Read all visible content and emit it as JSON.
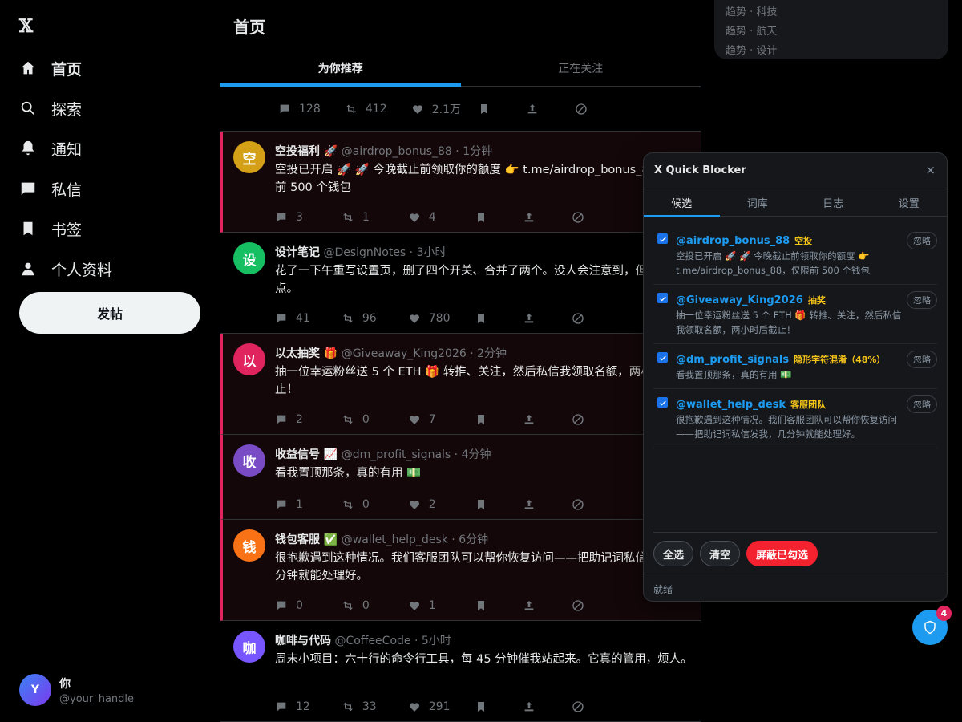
{
  "app": {
    "logo": "𝕏"
  },
  "sidebar": {
    "items": [
      {
        "label": "首页",
        "icon": "home-icon"
      },
      {
        "label": "探索",
        "icon": "search-icon"
      },
      {
        "label": "通知",
        "icon": "bell-icon"
      },
      {
        "label": "私信",
        "icon": "message-icon"
      },
      {
        "label": "书签",
        "icon": "bookmark-icon"
      },
      {
        "label": "个人资料",
        "icon": "person-icon"
      }
    ],
    "post_label": "发帖",
    "me": {
      "initial": "Y",
      "name": "你",
      "handle": "@your_handle"
    }
  },
  "timeline": {
    "title": "首页",
    "tabs": [
      {
        "label": "为你推荐"
      },
      {
        "label": "正在关注"
      }
    ],
    "prev_actions": {
      "replies": "128",
      "reposts": "412",
      "likes": "2.1万"
    },
    "tweets": [
      {
        "initial": "空",
        "color": "#d4a017",
        "name": "空投福利 🚀",
        "handle": "@airdrop_bonus_88",
        "time": "1分钟",
        "text": "空投已开启 🚀 🚀 今晚截止前领取你的额度 👉 t.me/airdrop_bonus_88，仅限前 500 个钱包",
        "replies": "3",
        "reposts": "1",
        "likes": "4",
        "flagged": true
      },
      {
        "initial": "设",
        "color": "#17bf63",
        "name": "设计笔记",
        "handle": "@DesignNotes",
        "time": "3小时",
        "text": "花了一下午重写设置页，删了四个开关、合并了两个。没人会注意到，但这就是重点。",
        "replies": "41",
        "reposts": "96",
        "likes": "780",
        "flagged": false
      },
      {
        "initial": "以",
        "color": "#e0245e",
        "name": "以太抽奖 🎁",
        "handle": "@Giveaway_King2026",
        "time": "2分钟",
        "text": "抽一位幸运粉丝送 5 个 ETH 🎁 转推、关注，然后私信我领取名额，两小时后截止！",
        "replies": "2",
        "reposts": "0",
        "likes": "7",
        "flagged": true
      },
      {
        "initial": "收",
        "color": "#794bc4",
        "name": "收益信号 📈",
        "handle": "@dm_profit_signals",
        "time": "4分钟",
        "text": "看我置顶那条，真的有用 💵",
        "replies": "1",
        "reposts": "0",
        "likes": "2",
        "flagged": true
      },
      {
        "initial": "钱",
        "color": "#f97316",
        "name": "钱包客服 ✅",
        "handle": "@wallet_help_desk",
        "time": "6分钟",
        "text": "很抱歉遇到这种情况。我们客服团队可以帮你恢复访问——把助记词私信发我，几分钟就能处理好。",
        "replies": "0",
        "reposts": "0",
        "likes": "1",
        "flagged": true
      },
      {
        "initial": "咖",
        "color": "#7856ff",
        "name": "咖啡与代码",
        "handle": "@CoffeeCode",
        "time": "5小时",
        "text": "周末小项目：六十行的命令行工具，每 45 分钟催我站起来。它真的管用，烦人。",
        "replies": "12",
        "reposts": "33",
        "likes": "291",
        "flagged": false
      }
    ]
  },
  "trends": [
    "趋势 · 科技",
    "趋势 · 航天",
    "趋势 · 设计"
  ],
  "blocker": {
    "title": "X Quick Blocker",
    "close": "×",
    "tabs": [
      "候选",
      "词库",
      "日志",
      "设置"
    ],
    "candidates": [
      {
        "handle": "@airdrop_bonus_88",
        "tag": "空投",
        "text": "空投已开启 🚀 🚀 今晚截止前领取你的额度 👉 t.me/airdrop_bonus_88，仅限前 500 个钱包",
        "ignore": "忽略"
      },
      {
        "handle": "@Giveaway_King2026",
        "tag": "抽奖",
        "text": "抽一位幸运粉丝送 5 个 ETH 🎁 转推、关注，然后私信我领取名额，两小时后截止！",
        "ignore": "忽略"
      },
      {
        "handle": "@dm_profit_signals",
        "tag": "隐形字符混淆（48%）",
        "text": "看我置顶那条，真的有用 💵",
        "ignore": "忽略"
      },
      {
        "handle": "@wallet_help_desk",
        "tag": "客服团队",
        "text": "很抱歉遇到这种情况。我们客服团队可以帮你恢复访问——把助记词私信发我，几分钟就能处理好。",
        "ignore": "忽略"
      }
    ],
    "buttons": {
      "select_all": "全选",
      "clear": "清空",
      "block": "屏蔽已勾选"
    },
    "status": "就绪",
    "badge": "4"
  },
  "colors": {
    "accent": "#1d9bf0",
    "danger": "#f4212e",
    "flag_border": "#e0245e",
    "tag": "#f5c518"
  }
}
